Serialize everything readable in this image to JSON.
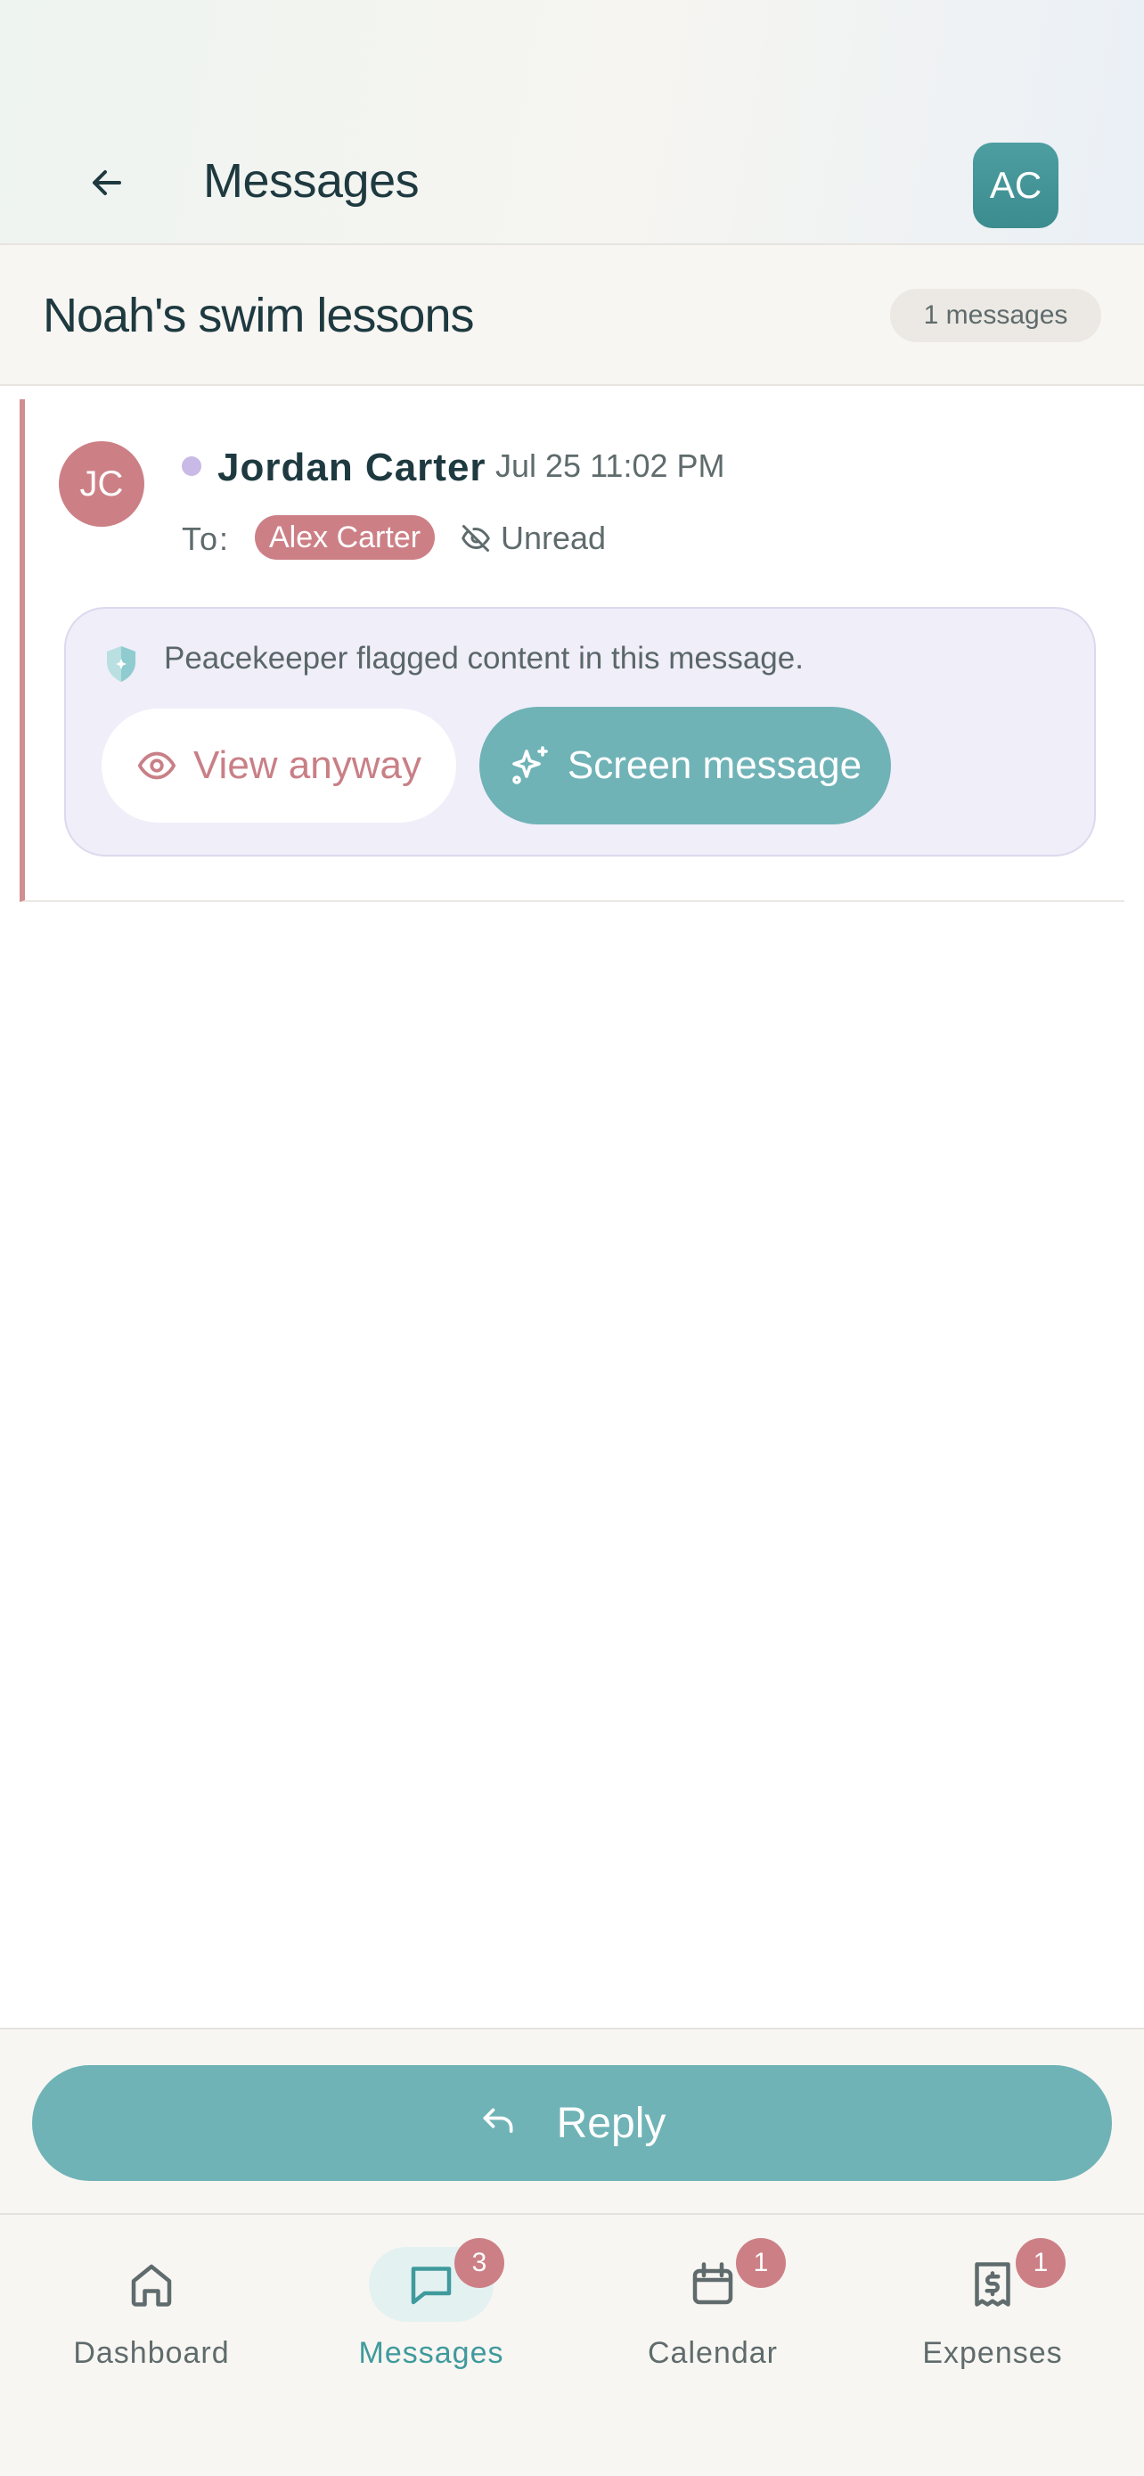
{
  "header": {
    "title": "Messages",
    "avatar_initials": "AC"
  },
  "thread": {
    "subject": "Noah's swim lessons",
    "count_label": "1 messages"
  },
  "message": {
    "sender_initials": "JC",
    "sender_name": "Jordan Carter",
    "timestamp": "Jul 25 11:02 PM",
    "to_label": "To:",
    "recipient": "Alex Carter",
    "read_status": "Unread",
    "flag_notice": "Peacekeeper flagged content in this message.",
    "view_anyway_label": "View anyway",
    "screen_message_label": "Screen message"
  },
  "reply": {
    "label": "Reply"
  },
  "nav": {
    "items": [
      {
        "label": "Dashboard",
        "icon": "home-icon",
        "badge": ""
      },
      {
        "label": "Messages",
        "icon": "message-icon",
        "badge": "3"
      },
      {
        "label": "Calendar",
        "icon": "calendar-icon",
        "badge": "1"
      },
      {
        "label": "Expenses",
        "icon": "receipt-icon",
        "badge": "1"
      }
    ]
  },
  "colors": {
    "accent_teal": "#6fb3b7",
    "accent_rose": "#cc8086",
    "flag_bg": "#f0eef9"
  }
}
